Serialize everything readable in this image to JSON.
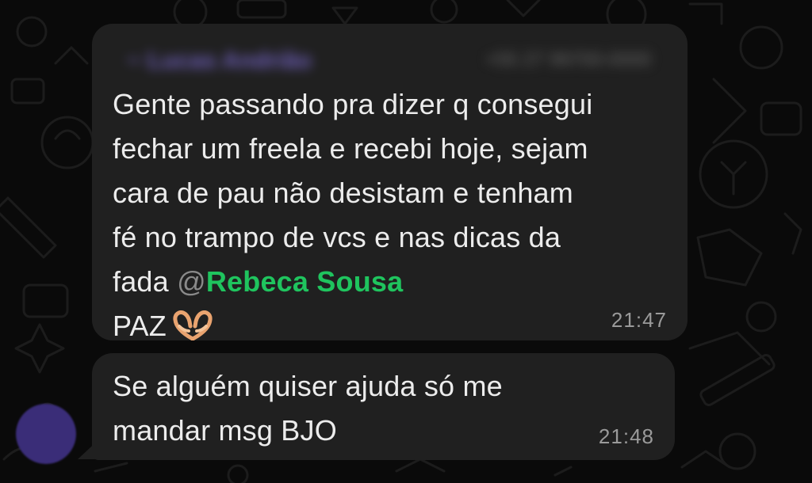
{
  "colors": {
    "background": "#0a0a0a",
    "bubble": "#202020",
    "text": "#ececec",
    "mention_highlight": "#1fc45e",
    "timestamp": "#9a9a9a",
    "sender_name": "#7d6bd6",
    "avatar": "#3a2d78"
  },
  "messages": [
    {
      "sender": "~ Lucas Andrião",
      "sender_meta": "+55 27 99700-0000",
      "lines": [
        "Gente passando pra dizer q consegui",
        "fechar um freela e recebi hoje, sejam",
        "cara de pau não desistam e tenham",
        "fé no trampo de vcs e nas dicas da"
      ],
      "mention_prefix": "fada ",
      "mention_at": "@",
      "mention_name": "Rebeca Sousa",
      "last_line": "PAZ",
      "emoji_icon": "heart-hands-icon",
      "time": "21:47"
    },
    {
      "lines": [
        "Se alguém quiser ajuda só me",
        "mandar msg BJO"
      ],
      "time": "21:48"
    }
  ]
}
